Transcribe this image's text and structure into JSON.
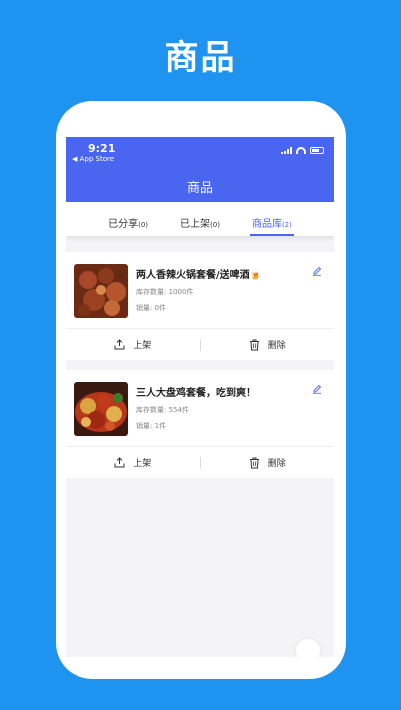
{
  "promo": {
    "title": "商品"
  },
  "status_bar": {
    "time": "9:21",
    "back_label": "◀ App Store"
  },
  "app": {
    "title": "商品"
  },
  "tabs": [
    {
      "label": "已分享",
      "count": "(0)"
    },
    {
      "label": "已上架",
      "count": "(0)"
    },
    {
      "label": "商品库",
      "count": "(2)"
    }
  ],
  "active_tab": "商品库",
  "products": [
    {
      "name": "两人香辣火锅套餐/送啤酒🍺",
      "stock_label": "库存数量:",
      "stock": "1000件",
      "sales_label": "销量:",
      "sales": "0件"
    },
    {
      "name": "三人大盘鸡套餐，吃到爽！",
      "stock_label": "库存数量:",
      "stock": "554件",
      "sales_label": "销量:",
      "sales": "1件"
    }
  ],
  "actions": {
    "shelve": "上架",
    "delete": "删除"
  },
  "colors": {
    "background": "#1e93ef",
    "accent": "#4a66f0"
  }
}
